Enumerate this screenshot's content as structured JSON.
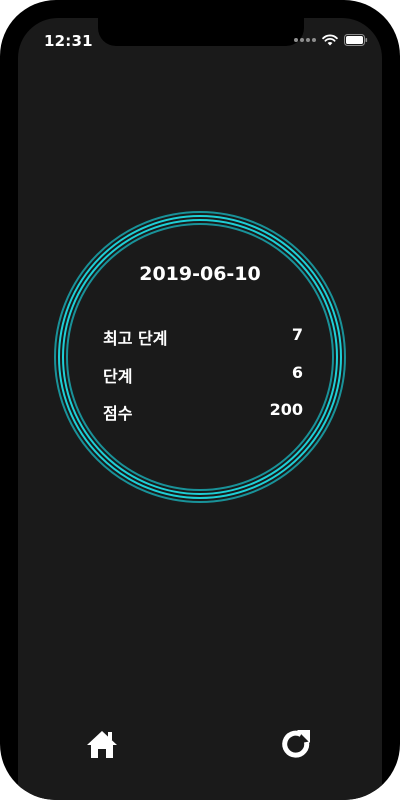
{
  "status_bar": {
    "time": "12:31"
  },
  "result": {
    "date": "2019-06-10",
    "rows": [
      {
        "label": "최고 단계",
        "value": "7"
      },
      {
        "label": "단계",
        "value": "6"
      },
      {
        "label": "점수",
        "value": "200"
      }
    ]
  },
  "colors": {
    "background": "#1a1a1a",
    "ring_accent": "#1ecfd6",
    "text": "#ffffff"
  },
  "icons": {
    "home": "home-icon",
    "refresh": "refresh-icon"
  }
}
